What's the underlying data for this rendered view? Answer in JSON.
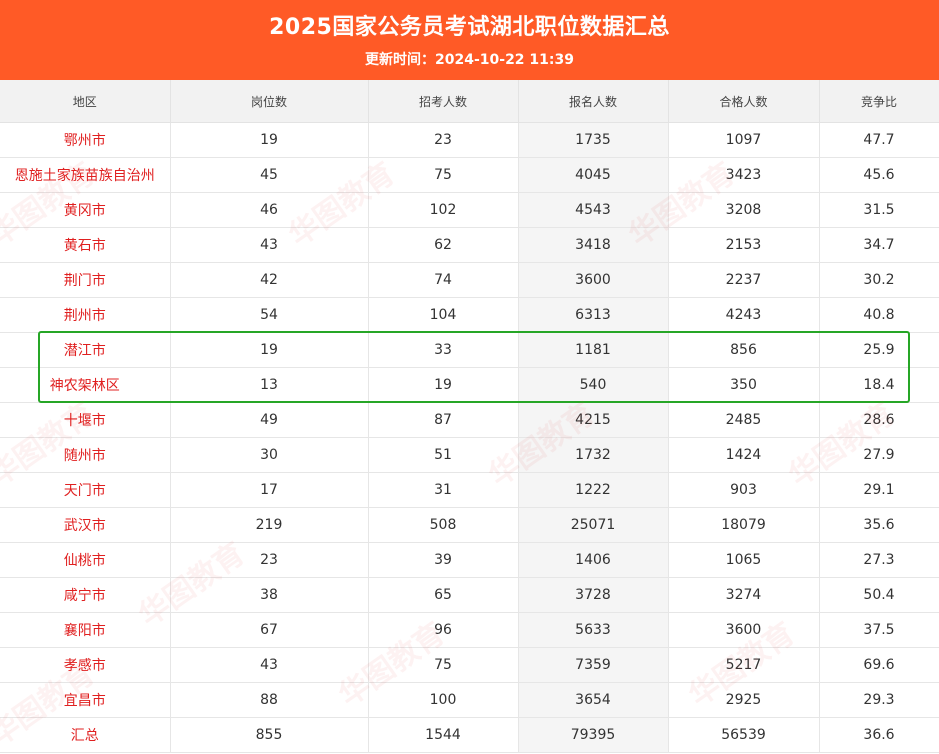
{
  "header": {
    "title": "2025国家公务员考试湖北职位数据汇总",
    "updated": "更新时间：2024-10-22 11:39"
  },
  "table": {
    "columns": [
      "地区",
      "岗位数",
      "招考人数",
      "报名人数",
      "合格人数",
      "竞争比"
    ],
    "rows": [
      {
        "region": "鄂州市",
        "posts": "19",
        "recruit": "23",
        "applied": "1735",
        "qualified": "1097",
        "ratio": "47.7"
      },
      {
        "region": "恩施土家族苗族自治州",
        "posts": "45",
        "recruit": "75",
        "applied": "4045",
        "qualified": "3423",
        "ratio": "45.6"
      },
      {
        "region": "黄冈市",
        "posts": "46",
        "recruit": "102",
        "applied": "4543",
        "qualified": "3208",
        "ratio": "31.5"
      },
      {
        "region": "黄石市",
        "posts": "43",
        "recruit": "62",
        "applied": "3418",
        "qualified": "2153",
        "ratio": "34.7"
      },
      {
        "region": "荆门市",
        "posts": "42",
        "recruit": "74",
        "applied": "3600",
        "qualified": "2237",
        "ratio": "30.2"
      },
      {
        "region": "荆州市",
        "posts": "54",
        "recruit": "104",
        "applied": "6313",
        "qualified": "4243",
        "ratio": "40.8"
      },
      {
        "region": "潜江市",
        "posts": "19",
        "recruit": "33",
        "applied": "1181",
        "qualified": "856",
        "ratio": "25.9"
      },
      {
        "region": "神农架林区",
        "posts": "13",
        "recruit": "19",
        "applied": "540",
        "qualified": "350",
        "ratio": "18.4"
      },
      {
        "region": "十堰市",
        "posts": "49",
        "recruit": "87",
        "applied": "4215",
        "qualified": "2485",
        "ratio": "28.6"
      },
      {
        "region": "随州市",
        "posts": "30",
        "recruit": "51",
        "applied": "1732",
        "qualified": "1424",
        "ratio": "27.9"
      },
      {
        "region": "天门市",
        "posts": "17",
        "recruit": "31",
        "applied": "1222",
        "qualified": "903",
        "ratio": "29.1"
      },
      {
        "region": "武汉市",
        "posts": "219",
        "recruit": "508",
        "applied": "25071",
        "qualified": "18079",
        "ratio": "35.6"
      },
      {
        "region": "仙桃市",
        "posts": "23",
        "recruit": "39",
        "applied": "1406",
        "qualified": "1065",
        "ratio": "27.3"
      },
      {
        "region": "咸宁市",
        "posts": "38",
        "recruit": "65",
        "applied": "3728",
        "qualified": "3274",
        "ratio": "50.4"
      },
      {
        "region": "襄阳市",
        "posts": "67",
        "recruit": "96",
        "applied": "5633",
        "qualified": "3600",
        "ratio": "37.5"
      },
      {
        "region": "孝感市",
        "posts": "43",
        "recruit": "75",
        "applied": "7359",
        "qualified": "5217",
        "ratio": "69.6"
      },
      {
        "region": "宜昌市",
        "posts": "88",
        "recruit": "100",
        "applied": "3654",
        "qualified": "2925",
        "ratio": "29.3"
      },
      {
        "region": "汇总",
        "posts": "855",
        "recruit": "1544",
        "applied": "79395",
        "qualified": "56539",
        "ratio": "36.6"
      }
    ]
  },
  "watermark": "华图教育",
  "colors": {
    "header_bg": "#ff5a26",
    "region_text": "#e02020",
    "highlight_border": "#26a626"
  }
}
